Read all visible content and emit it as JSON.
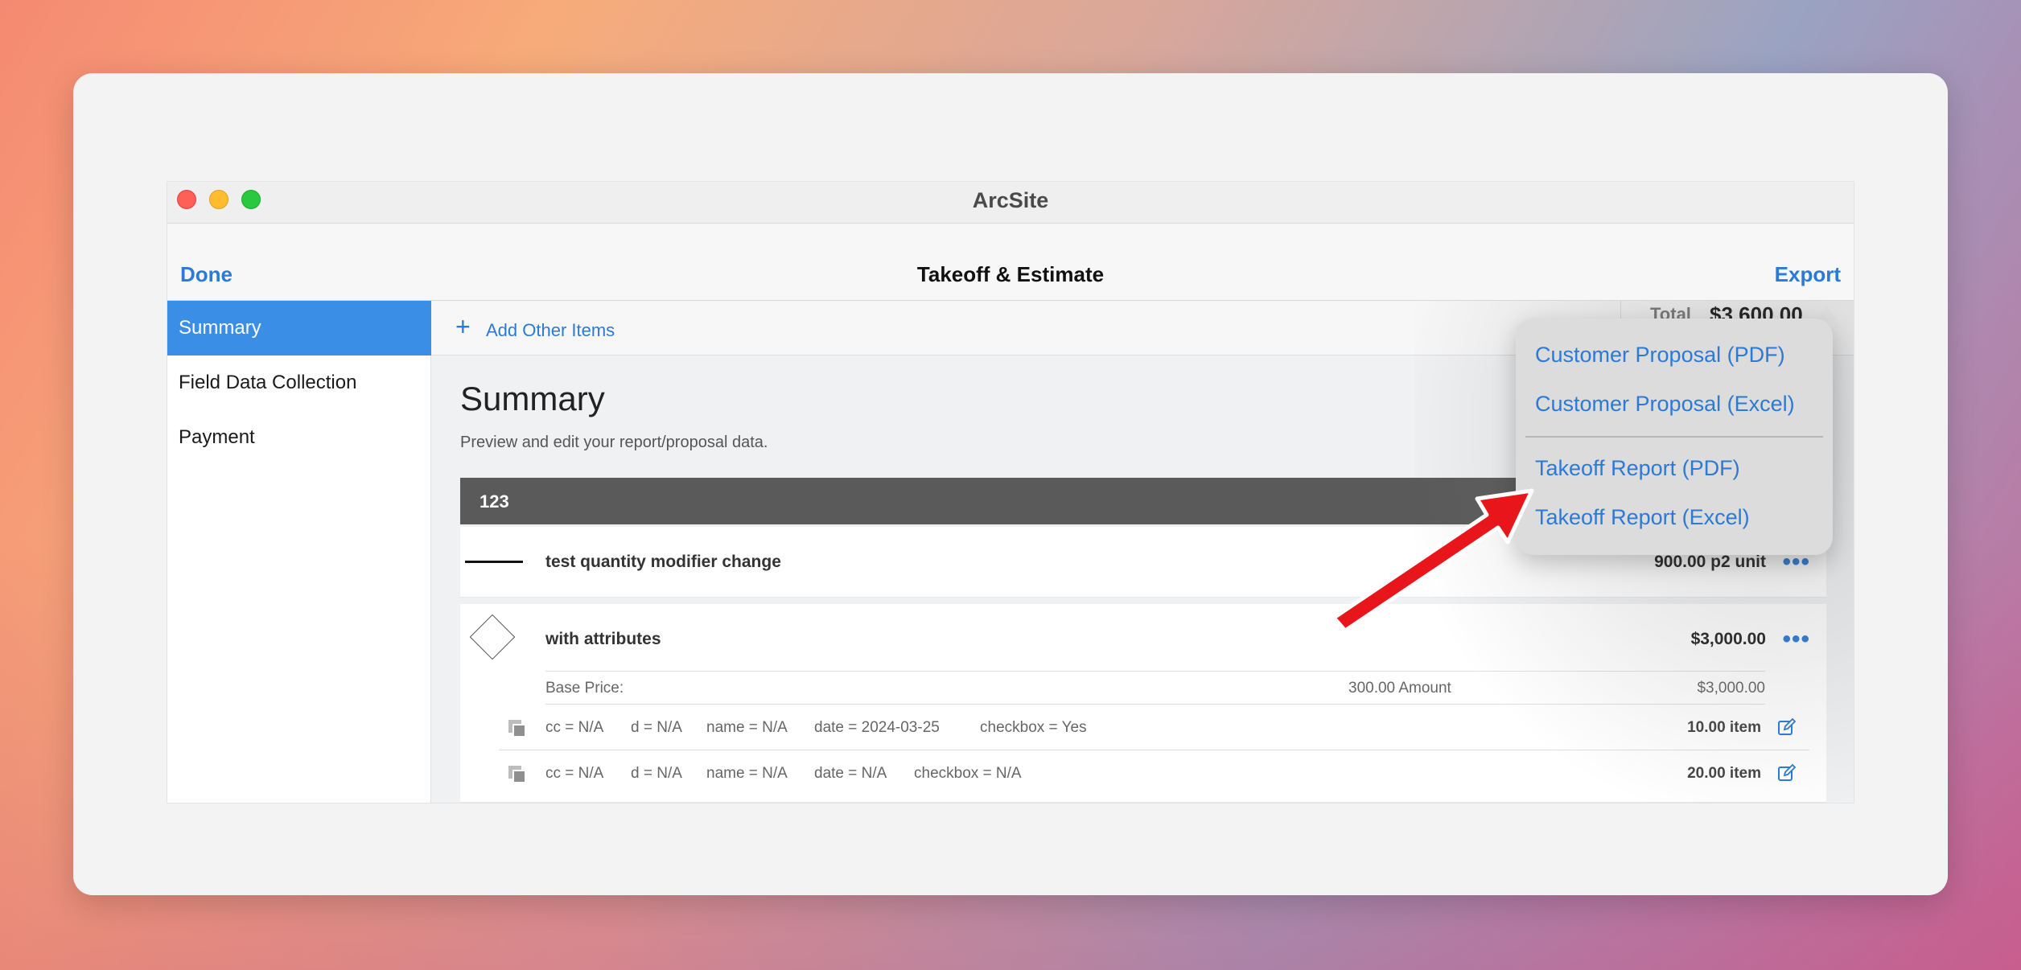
{
  "window": {
    "title": "ArcSite"
  },
  "nav": {
    "done": "Done",
    "title": "Takeoff & Estimate",
    "export": "Export"
  },
  "sidebar": {
    "items": [
      {
        "label": "Summary",
        "active": true
      },
      {
        "label": "Field Data Collection",
        "active": false
      },
      {
        "label": "Payment",
        "active": false
      }
    ]
  },
  "toolbar": {
    "add_icon": "+",
    "add_label": "Add Other Items",
    "total_label": "Total",
    "total_value": "$3,600.00"
  },
  "summary": {
    "title": "Summary",
    "subtitle": "Preview and edit your report/proposal data."
  },
  "group": {
    "name": "123"
  },
  "rows": [
    {
      "icon": "line-icon",
      "name": "test quantity modifier change",
      "amount": "900.00 p2 unit",
      "more": "•••"
    },
    {
      "icon": "diamond-icon",
      "name": "with attributes",
      "amount": "$3,000.00",
      "more": "•••",
      "base_price": {
        "label": "Base Price:",
        "amount": "300.00 Amount",
        "total": "$3,000.00"
      },
      "attributes": [
        {
          "cc": "cc = N/A",
          "d": "d = N/A",
          "name": "name = N/A",
          "date": "date = 2024-03-25",
          "checkbox": "checkbox = Yes",
          "qty": "10.00 item"
        },
        {
          "cc": "cc = N/A",
          "d": "d = N/A",
          "name": "name = N/A",
          "date": "date = N/A",
          "checkbox": "checkbox = N/A",
          "qty": "20.00 item"
        }
      ]
    }
  ],
  "export_menu": {
    "items": [
      "Customer Proposal (PDF)",
      "Customer Proposal (Excel)",
      "Takeoff Report (PDF)",
      "Takeoff Report (Excel)"
    ]
  },
  "colors": {
    "accent": "#2a7ad6",
    "sidebar_active": "#3a8ee6",
    "group_header": "#5a5a5a",
    "arrow": "#e8161b"
  }
}
